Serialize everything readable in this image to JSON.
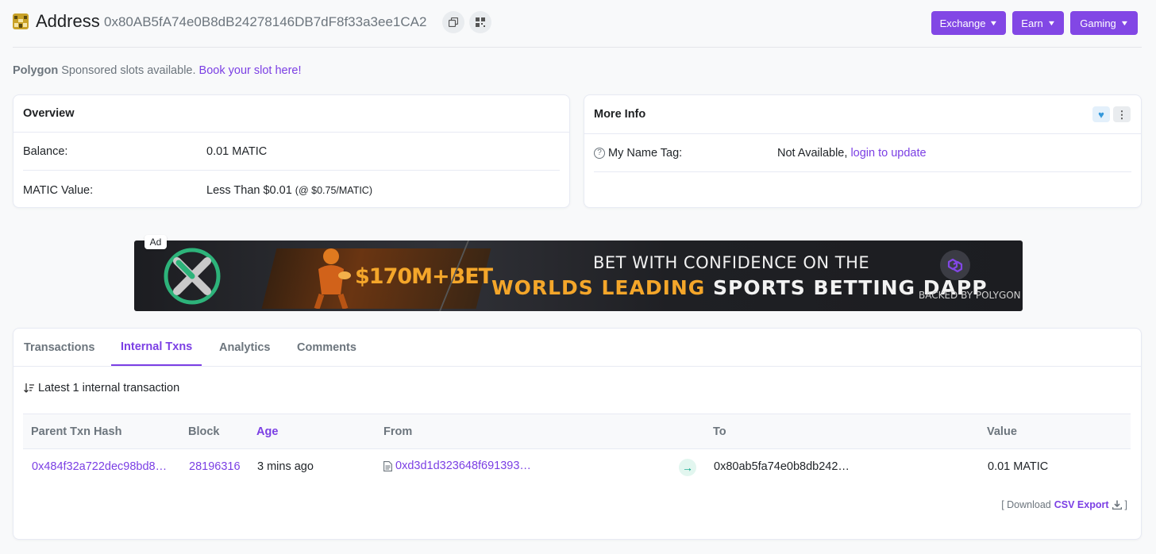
{
  "header": {
    "title": "Address",
    "address": "0x80AB5fA74e0B8dB24278146DB7dF8f33a3ee1CA2",
    "nav": [
      {
        "label": "Exchange"
      },
      {
        "label": "Earn"
      },
      {
        "label": "Gaming"
      }
    ]
  },
  "sponsored": {
    "brand": "Polygon",
    "text": "Sponsored slots available.",
    "link": "Book your slot here!"
  },
  "overview": {
    "title": "Overview",
    "balance_label": "Balance:",
    "balance_value": "0.01 MATIC",
    "value_label": "MATIC Value:",
    "value_value": "Less Than $0.01",
    "value_rate": "(@ $0.75/MATIC)"
  },
  "more_info": {
    "title": "More Info",
    "name_tag_label": "My Name Tag:",
    "name_tag_value": "Not Available,",
    "name_tag_link": "login to update"
  },
  "ad": {
    "tag": "Ad",
    "amount": "$170M+BET",
    "line1": "BET WITH CONFIDENCE ON THE",
    "line2_accent": "WORLDS LEADING",
    "line2_rest": "SPORTS BETTING DAPP",
    "backed": "BACKED BY POLYGON"
  },
  "tabs": [
    {
      "label": "Transactions"
    },
    {
      "label": "Internal Txns"
    },
    {
      "label": "Analytics"
    },
    {
      "label": "Comments"
    }
  ],
  "internal": {
    "summary": "Latest 1 internal transaction",
    "columns": {
      "parent": "Parent Txn Hash",
      "block": "Block",
      "age": "Age",
      "from": "From",
      "to": "To",
      "value": "Value"
    },
    "rows": [
      {
        "parent": "0x484f32a722dec98bd8…",
        "block": "28196316",
        "age": "3 mins ago",
        "from": "0xd3d1d323648f691393…",
        "to": "0x80ab5fa74e0b8db242…",
        "value": "0.01 MATIC"
      }
    ],
    "export_prefix": "[ Download",
    "export_link": "CSV Export",
    "export_suffix": "]"
  },
  "colors": {
    "accent": "#8247e5",
    "link": "#7b3fe4",
    "success": "#00a186"
  }
}
